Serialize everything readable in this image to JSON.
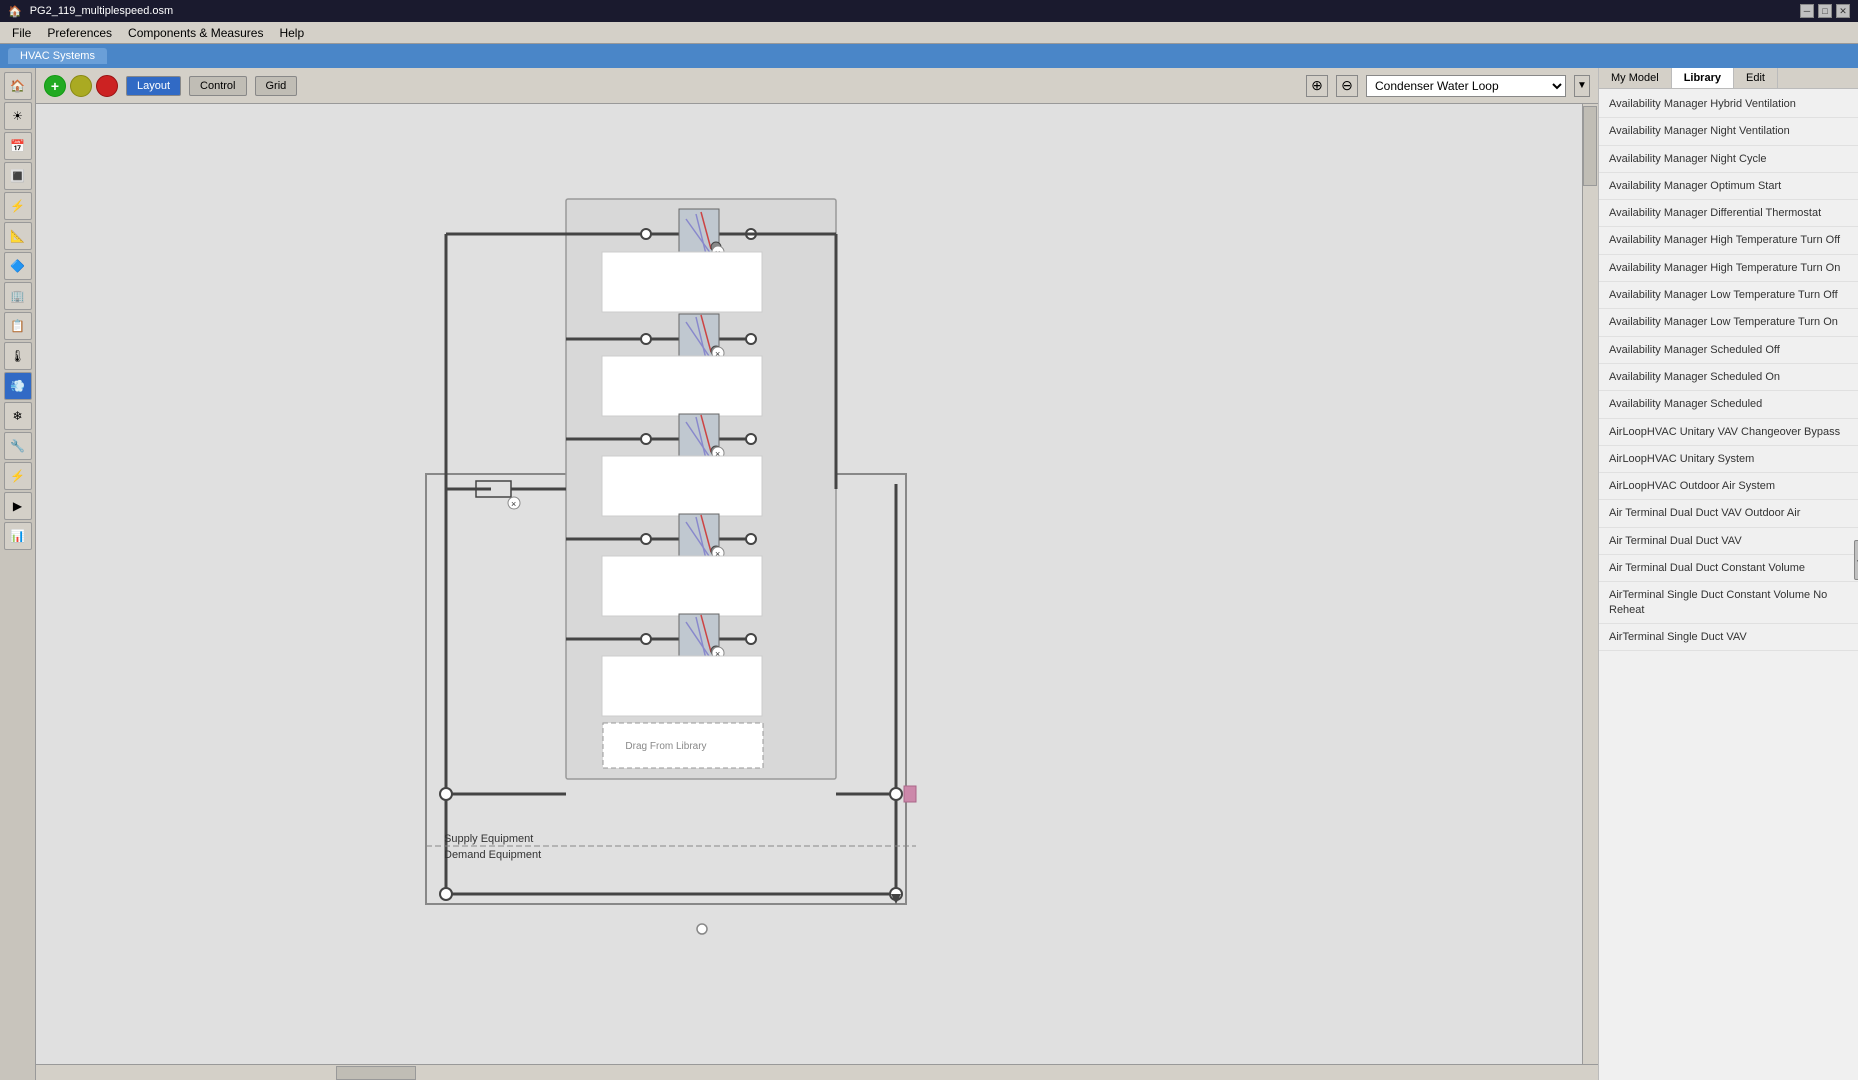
{
  "titlebar": {
    "title": "PG2_119_multiplespeed.osm",
    "minimize": "─",
    "maximize": "□",
    "close": "✕"
  },
  "menubar": {
    "items": [
      "File",
      "Preferences",
      "Components & Measures",
      "Help"
    ]
  },
  "hvac_tab": {
    "label": "HVAC Systems"
  },
  "toolbar": {
    "layout_btn": "Layout",
    "control_btn": "Control",
    "grid_btn": "Grid",
    "dropdown_value": "Condenser Water Loop",
    "dropdown_options": [
      "Condenser Water Loop"
    ]
  },
  "right_panel": {
    "tabs": [
      "My Model",
      "Library",
      "Edit"
    ],
    "active_tab": "Library",
    "library_items": [
      "Availability Manager Hybrid Ventilation",
      "Availability Manager Night Ventilation",
      "Availability Manager Night Cycle",
      "Availability Manager Optimum Start",
      "Availability Manager Differential Thermostat",
      "Availability Manager High Temperature Turn Off",
      "Availability Manager High Temperature Turn On",
      "Availability Manager Low Temperature Turn Off",
      "Availability Manager Low Temperature Turn On",
      "Availability Manager Scheduled Off",
      "Availability Manager Scheduled On",
      "Availability Manager Scheduled",
      "AirLoopHVAC Unitary VAV Changeover Bypass",
      "AirLoopHVAC Unitary System",
      "AirLoopHVAC Outdoor Air System",
      "Air Terminal Dual Duct VAV Outdoor Air",
      "Air Terminal Dual Duct VAV",
      "Air Terminal Dual Duct Constant Volume",
      "AirTerminal Single Duct Constant Volume No Reheat",
      "AirTerminal Single Duct VAV"
    ]
  },
  "diagram": {
    "drag_from_library": "Drag From Library",
    "supply_equipment": "Supply Equipment",
    "demand_equipment": "Demand Equipment"
  },
  "sidebar_icons": [
    "🏠",
    "📋",
    "🔧",
    "📦",
    "🌡",
    "💧",
    "⚡",
    "🔌",
    "📊",
    "▶",
    "📈"
  ],
  "colors": {
    "accent_blue": "#4a86c8",
    "active_tab": "#316ac5",
    "library_bg": "#f0f0f0",
    "canvas_bg": "#e0e0e0"
  }
}
